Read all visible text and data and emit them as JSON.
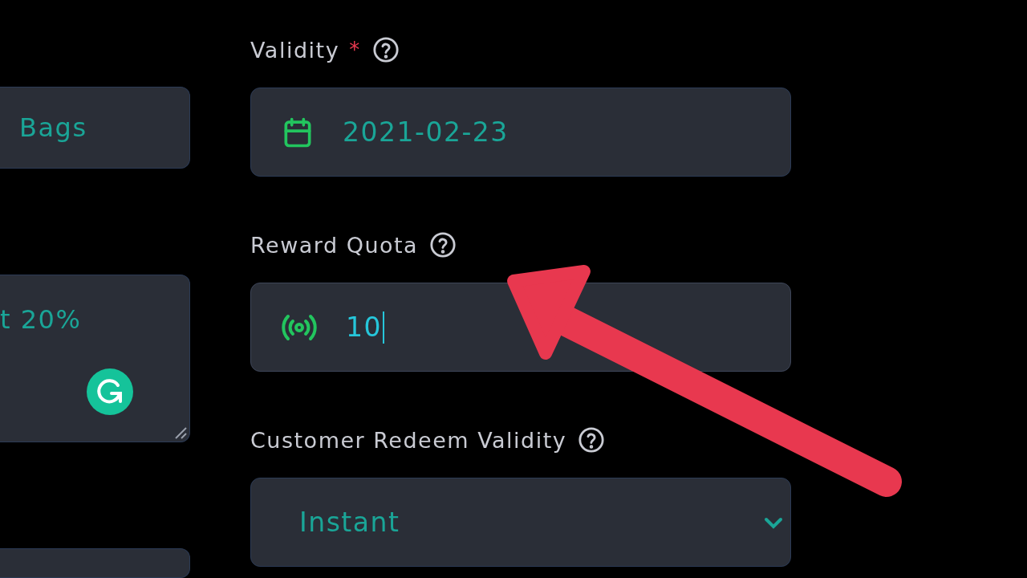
{
  "left_fields": [
    {
      "kind": "input",
      "value": "Bags"
    },
    {
      "kind": "textarea",
      "value": "t 20%"
    },
    {
      "kind": "input"
    }
  ],
  "right_fields": [
    {
      "label": "Validity",
      "required_mark": "*",
      "kind": "date",
      "value": "2021-02-23",
      "focused": false
    },
    {
      "label": "Reward Quota",
      "kind": "number",
      "value": "10",
      "focused": true
    },
    {
      "label": "Customer Redeem Validity",
      "kind": "select",
      "value": "Instant",
      "focused": false
    }
  ]
}
